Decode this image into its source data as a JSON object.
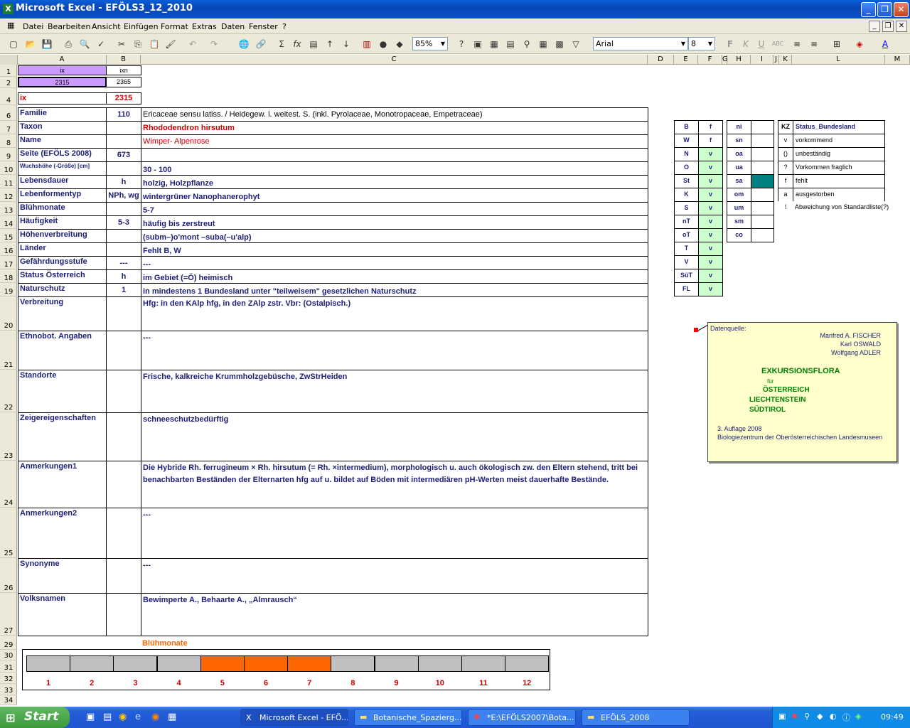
{
  "window": {
    "title": "Microsoft Excel - EFÖLS3_12_2010",
    "app_icon": "excel-icon"
  },
  "menu": [
    "Datei",
    "Bearbeiten",
    "Ansicht",
    "Einfügen",
    "Format",
    "Extras",
    "Daten",
    "Fenster",
    "?"
  ],
  "toolbar": {
    "zoom": "85%",
    "font": "Arial",
    "size": "8"
  },
  "columns": [
    "A",
    "B",
    "C",
    "D",
    "E",
    "F",
    "G",
    "H",
    "I",
    "J",
    "K",
    "L",
    "M"
  ],
  "rows": [
    "1",
    "2",
    "4",
    "6",
    "7",
    "8",
    "9",
    "10",
    "11",
    "12",
    "13",
    "14",
    "15",
    "16",
    "17",
    "18",
    "19",
    "20",
    "21",
    "22",
    "23",
    "24",
    "25",
    "26",
    "27",
    "29",
    "30",
    "31",
    "32",
    "33",
    "34"
  ],
  "top": {
    "a1": "ix",
    "b1": "ixn",
    "a2": "2315",
    "b2": "2365",
    "a4": "ix",
    "b4": "2315"
  },
  "fields": [
    {
      "label": "Familie",
      "code": "110",
      "value": "Ericaceae sensu latiss.  /  Heidegew. i. weitest. S. (inkl. Pyrolaceae, Monotropaceae, Empetraceae)"
    },
    {
      "label": "Taxon",
      "code": "",
      "value": "Rhododendron hirsutum"
    },
    {
      "label": "Name",
      "code": "",
      "value": "Wimper- Alpenrose"
    },
    {
      "label": "Seite (EFÖLS 2008)",
      "code": "673",
      "value": ""
    },
    {
      "label": "Wuchshöhe (-Größe) [cm]",
      "code": "",
      "value": " 30 - 100"
    },
    {
      "label": "Lebensdauer",
      "code": "h",
      "value": "holzig, Holzpflanze"
    },
    {
      "label": "Lebenformentyp",
      "code": "NPh, wg",
      "value": "wintergrüner Nanophanerophyt"
    },
    {
      "label": "Blühmonate",
      "code": "",
      "value": " 5-7"
    },
    {
      "label": "Häufigkeit",
      "code": "5-3",
      "value": "häufig bis zerstreut"
    },
    {
      "label": "Höhenverbreitung",
      "code": "",
      "value": "(subm–)o'mont –suba(–u'alp)"
    },
    {
      "label": "Länder",
      "code": "",
      "value": "Fehlt B, W"
    },
    {
      "label": "Gefährdungsstufe",
      "code": "---",
      "value": "  ---"
    },
    {
      "label": "Status Österreich",
      "code": "h",
      "value": "im Gebiet (=Ö) heimisch"
    },
    {
      "label": "Naturschutz",
      "code": "1",
      "value": "in mindestens 1 Bundesland unter \"teilweisem\" gesetzlichen Naturschutz"
    },
    {
      "label": "Verbreitung",
      "code": "",
      "value": "Hfg:  in den KAlp hfg, in den ZAlp zstr.  Vbr: (Ostalpisch.)"
    },
    {
      "label": "Ethnobot. Angaben",
      "code": "",
      "value": "---"
    },
    {
      "label": "Standorte",
      "code": "",
      "value": "Frische, kalkreiche Krummholzgebüsche, ZwStrHeiden"
    },
    {
      "label": "Zeigereigenschaften",
      "code": "",
      "value": "schneeschutzbedürftig"
    },
    {
      "label": "Anmerkungen1",
      "code": "",
      "value": "Die Hybride Rh. ferrugineum × Rh. hirsutum (= Rh. ×intermedium), morphologisch u. auch ökologisch zw. den Eltern stehend, tritt bei benachbarten Beständen der Elternarten hfg auf u. bildet auf Böden mit intermediären pH-Werten meist dauerhafte Bestände."
    },
    {
      "label": "Anmerkungen2",
      "code": "",
      "value": "---"
    },
    {
      "label": "Synonyme",
      "code": "",
      "value": "---"
    },
    {
      "label": "Volksnamen",
      "code": "",
      "value": "Bewimperte A., Behaarte A., „Almrausch“"
    }
  ],
  "states": [
    {
      "k": "B",
      "v": "f"
    },
    {
      "k": "W",
      "v": "f"
    },
    {
      "k": "N",
      "v": "v"
    },
    {
      "k": "O",
      "v": "v"
    },
    {
      "k": "St",
      "v": "v"
    },
    {
      "k": "K",
      "v": "v"
    },
    {
      "k": "S",
      "v": "v"
    },
    {
      "k": "nT",
      "v": "v"
    },
    {
      "k": "oT",
      "v": "v"
    },
    {
      "k": "T",
      "v": "v"
    },
    {
      "k": "V",
      "v": "v"
    },
    {
      "k": "SüT",
      "v": "v"
    },
    {
      "k": "FL",
      "v": "v"
    }
  ],
  "zones": [
    "ni",
    "sn",
    "oa",
    "ua",
    "sa",
    "om",
    "um",
    "sm",
    "co"
  ],
  "legend": {
    "header_k": "KZ",
    "header": "Status_Bundesland",
    "items": [
      {
        "k": "v",
        "t": "vorkommend"
      },
      {
        "k": "()",
        "t": "unbeständig"
      },
      {
        "k": "?",
        "t": "Vorkommen fraglich"
      },
      {
        "k": "f",
        "t": "fehlt"
      },
      {
        "k": "a",
        "t": "ausgestorben"
      },
      {
        "k": "!",
        "t": "Abweichung von Standardliste(?)"
      }
    ]
  },
  "note": {
    "lbl": "Datenquelle:",
    "a1": "Manfred A. FISCHER",
    "a2": "Karl OSWALD",
    "a3": "Wolfgang ADLER",
    "t1": "EXKURSIONSFLORA",
    "t2": "für",
    "t3": "ÖSTERREICH",
    "t4": "LIECHTENSTEIN",
    "t5": "SÜDTIROL",
    "e1": "3. Auflage 2008",
    "e2": "Biologiezentrum der Oberösterreichischen Landesmuseen"
  },
  "bloom": {
    "title": "Blühmonate",
    "months": [
      "1",
      "2",
      "3",
      "4",
      "5",
      "6",
      "7",
      "8",
      "9",
      "10",
      "11",
      "12"
    ],
    "active": [
      5,
      6,
      7
    ],
    "active_color": "#ff6600",
    "inactive_color": "#c0c0c0"
  },
  "taskbar": {
    "start": "Start",
    "tasks": [
      "Microsoft Excel - EFÖ...",
      "Botanische_Spazierg...",
      "*E:\\EFÖLS2007\\Bota...",
      "EFÖLS_2008"
    ],
    "clock": "09:49"
  }
}
